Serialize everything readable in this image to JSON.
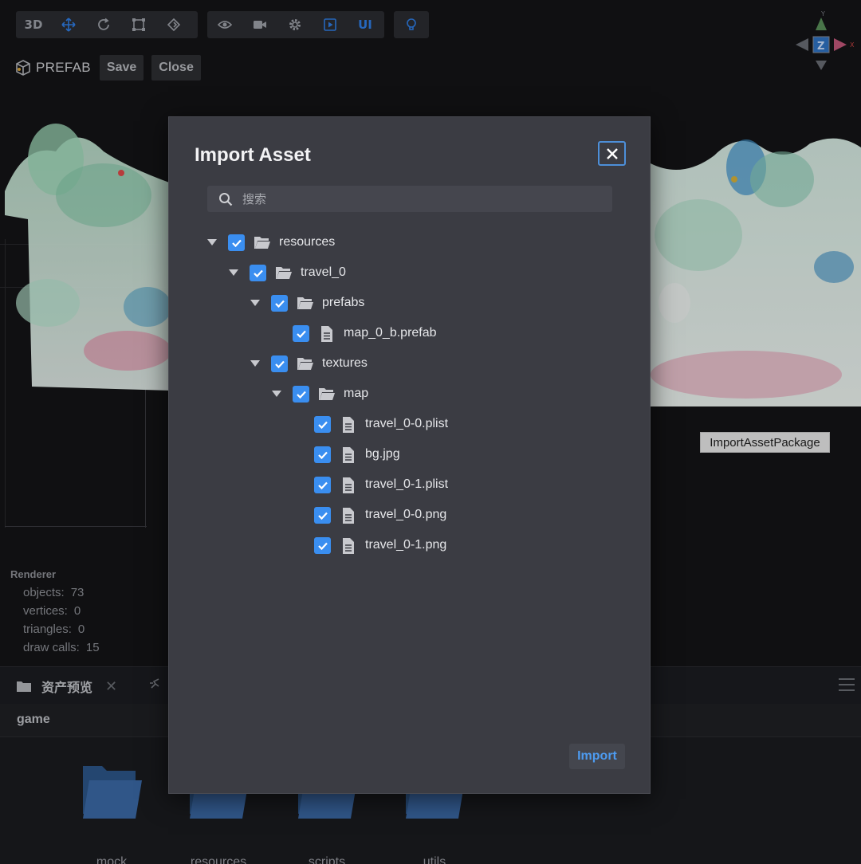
{
  "toolbar": {
    "mode_3d": "3D",
    "ui_label": "UI"
  },
  "prefab_bar": {
    "label": "PREFAB",
    "save": "Save",
    "close": "Close"
  },
  "gizmo": {
    "y": "Y",
    "z": "Z",
    "x": "X"
  },
  "tooltip": "ImportAssetPackage",
  "renderer": {
    "title": "Renderer",
    "stats": [
      {
        "key": "objects:",
        "value": "73"
      },
      {
        "key": "vertices:",
        "value": "0"
      },
      {
        "key": "triangles:",
        "value": "0"
      },
      {
        "key": "draw calls:",
        "value": "15"
      }
    ]
  },
  "assets_panel": {
    "tab_label": "资产预览",
    "breadcrumb": "game",
    "folders": [
      "mock",
      "resources",
      "scripts",
      "utils"
    ]
  },
  "dialog": {
    "title": "Import Asset",
    "search_placeholder": "搜索",
    "import_label": "Import",
    "tree": [
      {
        "label": "resources",
        "type": "folder",
        "depth": 0,
        "expanded": true,
        "checked": true
      },
      {
        "label": "travel_0",
        "type": "folder",
        "depth": 1,
        "expanded": true,
        "checked": true
      },
      {
        "label": "prefabs",
        "type": "folder",
        "depth": 2,
        "expanded": true,
        "checked": true
      },
      {
        "label": "map_0_b.prefab",
        "type": "file",
        "depth": 3,
        "checked": true
      },
      {
        "label": "textures",
        "type": "folder",
        "depth": 2,
        "expanded": true,
        "checked": true
      },
      {
        "label": "map",
        "type": "folder",
        "depth": 3,
        "expanded": true,
        "checked": true
      },
      {
        "label": "travel_0-0.plist",
        "type": "file",
        "depth": 4,
        "checked": true
      },
      {
        "label": "bg.jpg",
        "type": "file",
        "depth": 4,
        "checked": true
      },
      {
        "label": "travel_0-1.plist",
        "type": "file",
        "depth": 4,
        "checked": true
      },
      {
        "label": "travel_0-0.png",
        "type": "file",
        "depth": 4,
        "checked": true
      },
      {
        "label": "travel_0-1.png",
        "type": "file",
        "depth": 4,
        "checked": true
      }
    ]
  },
  "colors": {
    "accent": "#3a8ef0",
    "dialog_bg": "#3b3c43",
    "folder_blue": "#3b6aa6"
  }
}
